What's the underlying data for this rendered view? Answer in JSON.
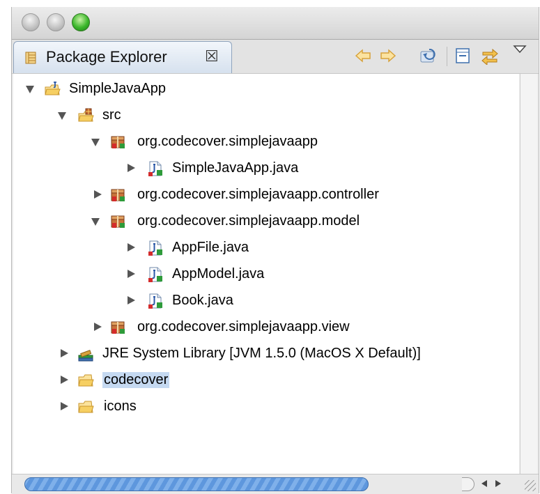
{
  "window": {
    "traffic_lights": [
      "close-button",
      "minimize-button",
      "zoom-button"
    ]
  },
  "tab": {
    "title": "Package Explorer",
    "close_glyph": "☒",
    "icon": "package-explorer-icon"
  },
  "toolbar": {
    "buttons": [
      "back-icon",
      "forward-icon",
      "up-icon",
      "collapse-all-icon",
      "link-with-editor-icon",
      "view-menu-icon"
    ]
  },
  "tree": {
    "project": "SimpleJavaApp",
    "src": "src",
    "pkg_main": "org.codecover.simplejavaapp",
    "file_main": "SimpleJavaApp.java",
    "pkg_controller": "org.codecover.simplejavaapp.controller",
    "pkg_model": "org.codecover.simplejavaapp.model",
    "file_appfile": "AppFile.java",
    "file_appmodel": "AppModel.java",
    "file_book": "Book.java",
    "pkg_view": "org.codecover.simplejavaapp.view",
    "jre": "JRE System Library [JVM 1.5.0 (MacOS X Default)]",
    "folder_codecover": "codecover",
    "folder_icons": "icons",
    "selected": "codecover"
  },
  "colors": {
    "selection": "#c5d9f1",
    "tab_border": "#8fa4bd",
    "scroll_thumb": "#5e97dd"
  }
}
